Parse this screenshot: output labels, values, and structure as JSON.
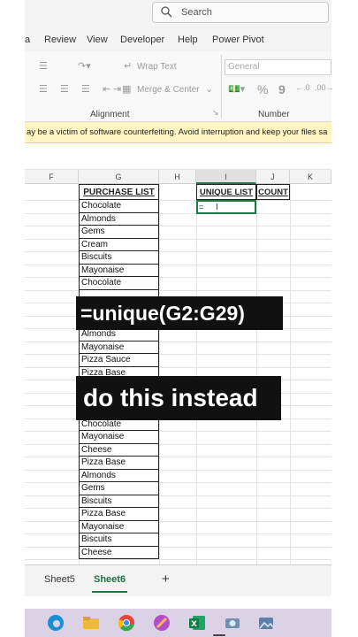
{
  "titlebar": {
    "search_placeholder": "Search"
  },
  "ribbon_tabs": [
    "a",
    "Review",
    "View",
    "Developer",
    "Help",
    "Power Pivot"
  ],
  "ribbon": {
    "wrap_text": "Wrap Text",
    "merge_center": "Merge & Center",
    "number_format": "General",
    "alignment_label": "Alignment",
    "number_label": "Number",
    "percent_symbol": "%",
    "comma_symbol": "9"
  },
  "warning": {
    "text": "ay be a victim of software counterfeiting. Avoid interruption and keep your files sa"
  },
  "columns": [
    "F",
    "G",
    "H",
    "I",
    "J",
    "K"
  ],
  "table": {
    "header": "PURCHASE LIST",
    "unique_header": "UNIQUE LIST",
    "count_header": "COUNT",
    "active_cell_value": "=",
    "items": [
      "Chocolate",
      "Almonds",
      "Gems",
      "Cream",
      "Biscuits",
      "Mayonaise",
      "Chocolate",
      "",
      "",
      "",
      "Almonds",
      "Mayonaise",
      "Pizza Sauce",
      "Pizza Base",
      "",
      "",
      "",
      "Chocolate",
      "Mayonaise",
      "Cheese",
      "Pizza Base",
      "Almonds",
      "Gems",
      "Biscuits",
      "Pizza Base",
      "Mayonaise",
      "Biscuits",
      "Cheese"
    ]
  },
  "overlays": {
    "formula": "=unique(G2:G29)",
    "caption": "do this instead"
  },
  "sheets": [
    "Sheet5",
    "Sheet6"
  ],
  "add_sheet": "+",
  "colors": {
    "excel_green": "#1f7a45",
    "warning_bg": "#fff4c2"
  }
}
